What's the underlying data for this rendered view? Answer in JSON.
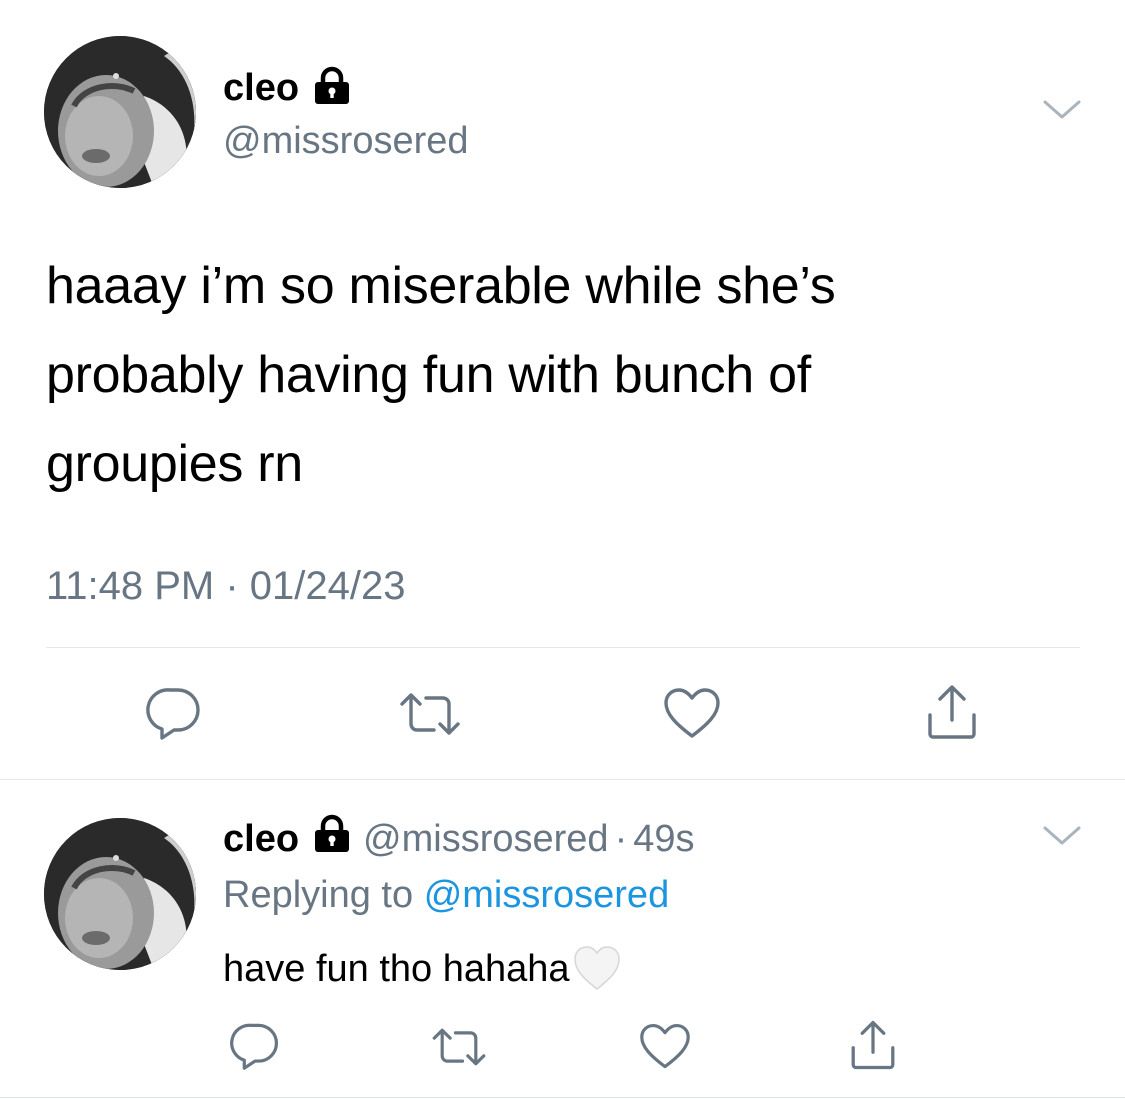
{
  "main_tweet": {
    "author_name": "cleo",
    "handle": "@missrosered",
    "text_lines": [
      "haaay i’m so miserable while she’s",
      "probably having fun with bunch of",
      "groupies rn"
    ],
    "timestamp": "11:48 PM · 01/24/23"
  },
  "reply": {
    "author_name": "cleo",
    "handle": "@missrosered",
    "time_ago": "49s",
    "replying_prefix": "Replying to",
    "replying_to": "@missrosered",
    "text": "have fun tho hahaha",
    "emoji": "🤍"
  },
  "icons": {
    "lock": "lock-icon",
    "chevron": "chevron-down-icon",
    "reply": "reply-icon",
    "retweet": "retweet-icon",
    "like": "heart-icon",
    "share": "share-icon"
  },
  "colors": {
    "text": "#000000",
    "muted": "#687684",
    "link": "#1b95e0",
    "divider": "#e1e8ed"
  }
}
